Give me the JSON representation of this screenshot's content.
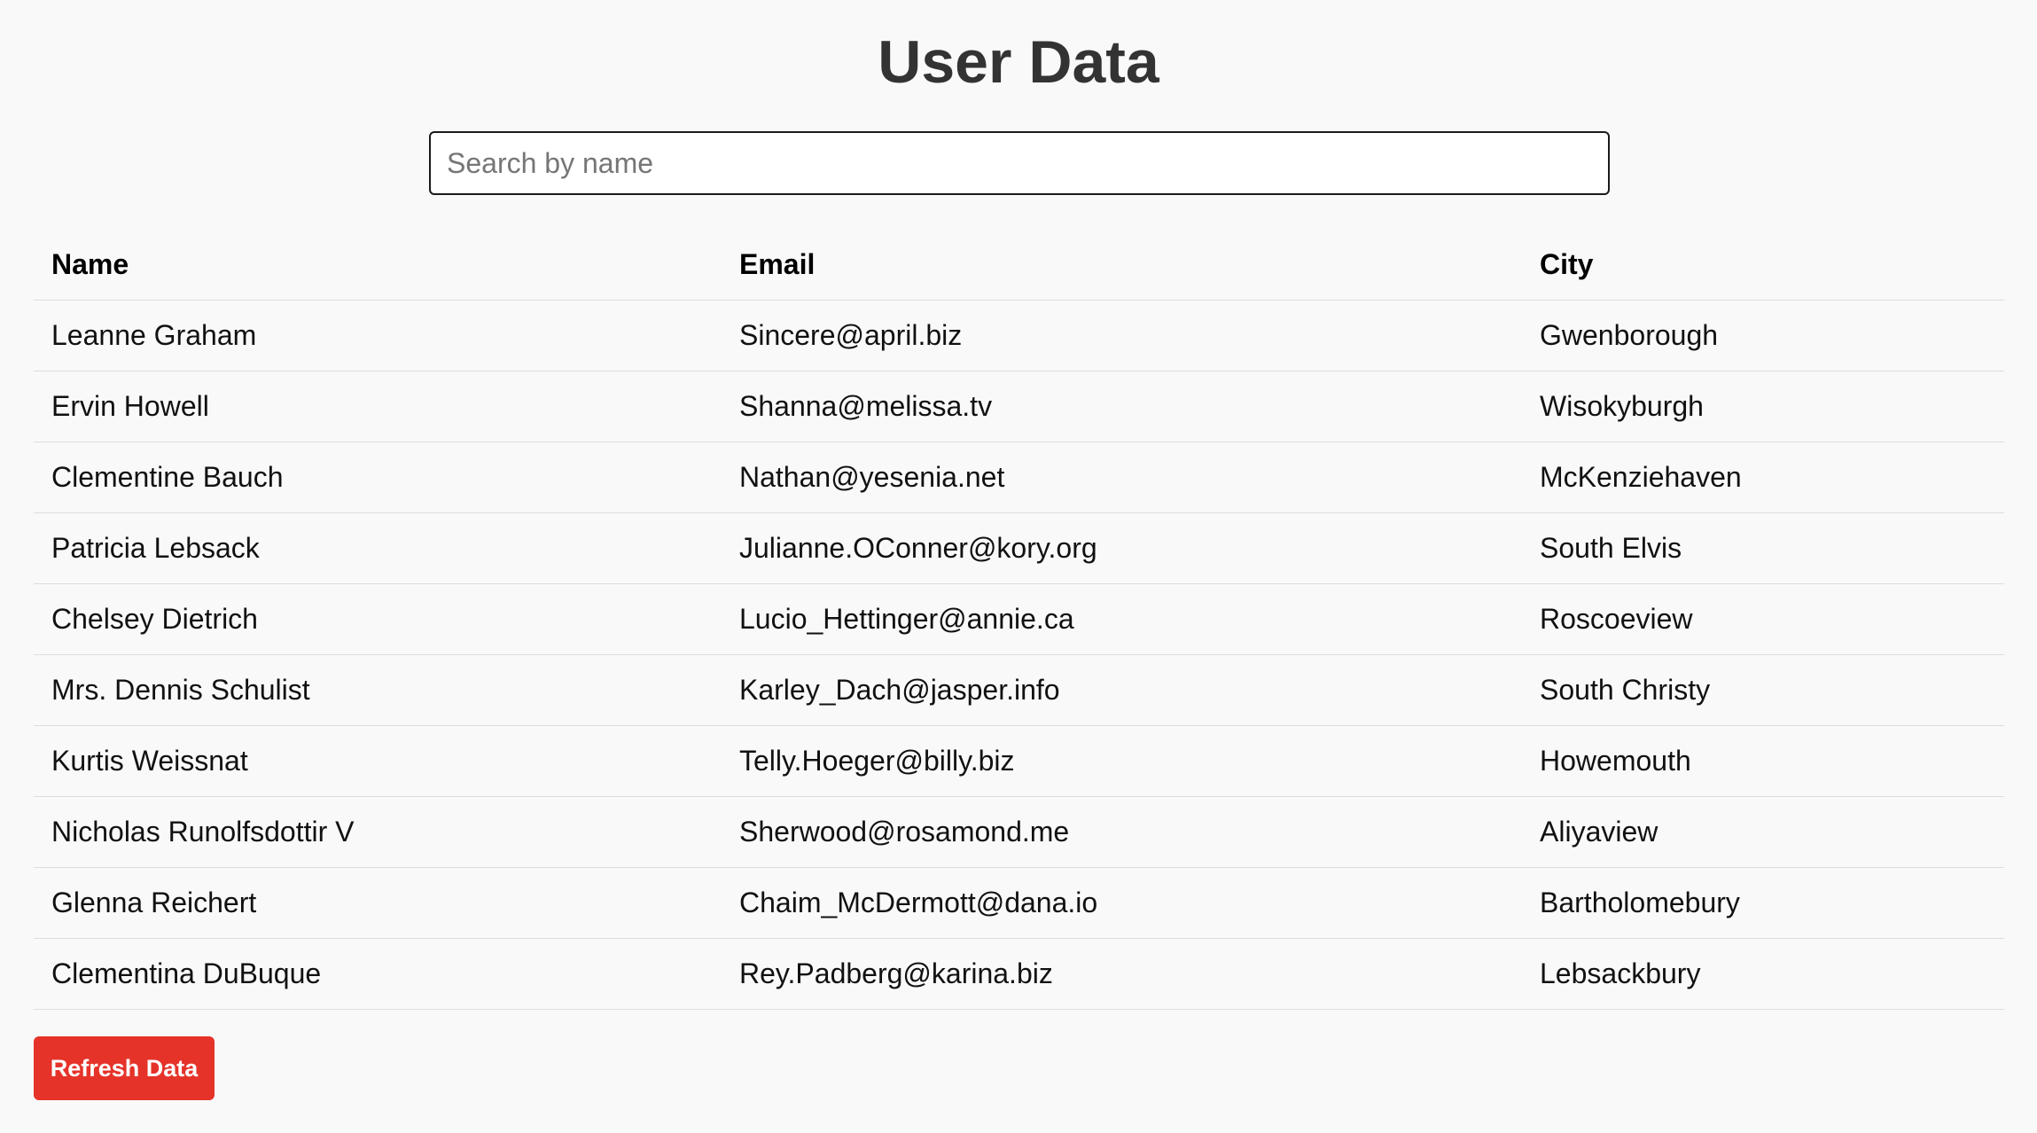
{
  "page": {
    "title": "User Data"
  },
  "search": {
    "placeholder": "Search by name",
    "value": ""
  },
  "table": {
    "headers": {
      "name": "Name",
      "email": "Email",
      "city": "City"
    },
    "rows": [
      {
        "name": "Leanne Graham",
        "email": "Sincere@april.biz",
        "city": "Gwenborough"
      },
      {
        "name": "Ervin Howell",
        "email": "Shanna@melissa.tv",
        "city": "Wisokyburgh"
      },
      {
        "name": "Clementine Bauch",
        "email": "Nathan@yesenia.net",
        "city": "McKenziehaven"
      },
      {
        "name": "Patricia Lebsack",
        "email": "Julianne.OConner@kory.org",
        "city": "South Elvis"
      },
      {
        "name": "Chelsey Dietrich",
        "email": "Lucio_Hettinger@annie.ca",
        "city": "Roscoeview"
      },
      {
        "name": "Mrs. Dennis Schulist",
        "email": "Karley_Dach@jasper.info",
        "city": "South Christy"
      },
      {
        "name": "Kurtis Weissnat",
        "email": "Telly.Hoeger@billy.biz",
        "city": "Howemouth"
      },
      {
        "name": "Nicholas Runolfsdottir V",
        "email": "Sherwood@rosamond.me",
        "city": "Aliyaview"
      },
      {
        "name": "Glenna Reichert",
        "email": "Chaim_McDermott@dana.io",
        "city": "Bartholomebury"
      },
      {
        "name": "Clementina DuBuque",
        "email": "Rey.Padberg@karina.biz",
        "city": "Lebsackbury"
      }
    ]
  },
  "actions": {
    "refresh_label": "Refresh Data"
  },
  "colors": {
    "accent": "#e53329",
    "title": "#333333",
    "row_divider": "#dddddd"
  }
}
